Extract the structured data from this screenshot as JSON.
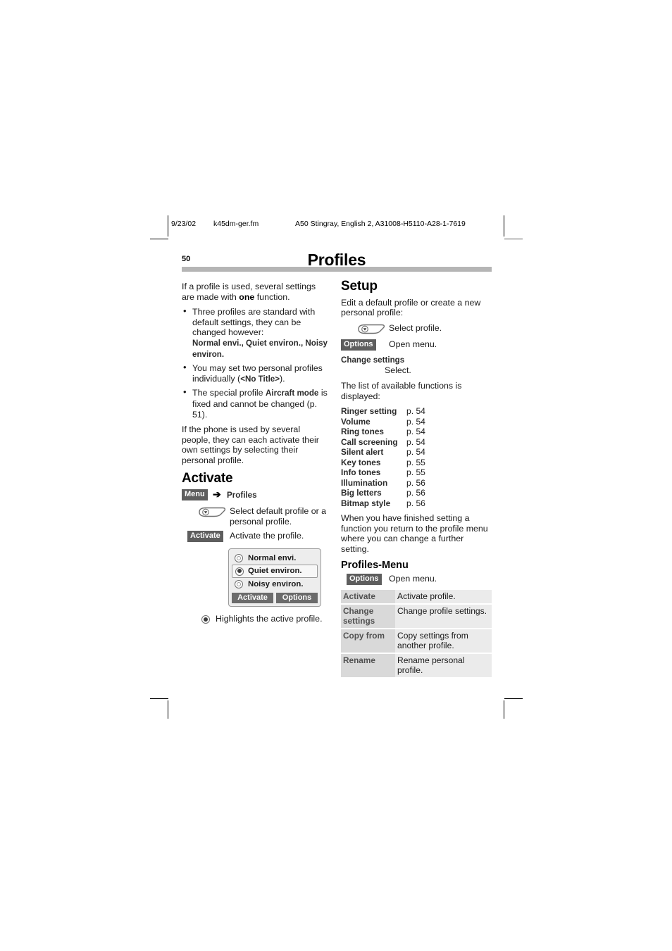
{
  "print_header": {
    "date": "9/23/02",
    "filename": "k45dm-ger.fm",
    "document": "A50 Stingray, English 2, A31008-H5110-A28-1-7619"
  },
  "page": {
    "number": "50",
    "title": "Profiles"
  },
  "left_column": {
    "intro_before": "If a profile is used, several settings are made with ",
    "intro_bold": "one",
    "intro_after": " function.",
    "bullets": [
      {
        "text": "Three profiles are standard with default settings, they can be changed however:",
        "keywords": "Normal envi., Quiet environ., Noisy environ."
      },
      {
        "text_before": "You may set two personal profiles individually (",
        "keyword": "<No Title>",
        "text_after": ")."
      },
      {
        "text_before": "The special profile ",
        "keyword": "Aircraft mode",
        "text_after": " is fixed and cannot be changed (p. 51)."
      }
    ],
    "closing": "If the phone is used by several people, they can each activate their own settings by selecting their personal profile.",
    "activate_heading": "Activate",
    "menu_path": {
      "chip": "Menu",
      "arrow": "➔",
      "target": "Profiles"
    },
    "steps": [
      {
        "key_icon": "rocker-down-key",
        "desc": "Select default profile or a personal profile."
      },
      {
        "chip": "Activate",
        "desc": "Activate the profile."
      }
    ],
    "mockup": {
      "rows": [
        {
          "label": "Normal envi.",
          "selected": false,
          "active": false
        },
        {
          "label": "Quiet environ.",
          "selected": true,
          "active": true
        },
        {
          "label": "Noisy environ.",
          "selected": false,
          "active": false
        }
      ],
      "softkeys": [
        "Activate",
        "Options"
      ]
    },
    "legend": "Highlights the active profile."
  },
  "right_column": {
    "setup_heading": "Setup",
    "setup_intro": "Edit a default profile or create a new personal profile:",
    "setup_steps": [
      {
        "key_icon": "rocker-down-key",
        "desc": "Select profile."
      },
      {
        "chip": "Options",
        "desc": "Open menu."
      }
    ],
    "change_settings_label": "Change settings",
    "change_settings_action": "Select.",
    "list_intro": "The list of available functions is displayed:",
    "functions": [
      {
        "name": "Ringer setting",
        "page": "p. 54"
      },
      {
        "name": "Volume",
        "page": "p. 54"
      },
      {
        "name": "Ring tones",
        "page": "p. 54"
      },
      {
        "name": "Call screening",
        "page": "p. 54"
      },
      {
        "name": "Silent alert",
        "page": "p. 54"
      },
      {
        "name": "Key tones",
        "page": "p. 55"
      },
      {
        "name": "Info tones",
        "page": "p. 55"
      },
      {
        "name": "Illumination",
        "page": "p. 56"
      },
      {
        "name": "Big letters",
        "page": "p. 56"
      },
      {
        "name": "Bitmap style",
        "page": "p. 56"
      }
    ],
    "after_list": "When you have finished setting a function you return to the profile menu where you can change a further setting.",
    "profiles_menu_heading": "Profiles-Menu",
    "profiles_menu_step": {
      "chip": "Options",
      "desc": "Open menu."
    },
    "options_table": [
      {
        "key": "Activate",
        "value": "Activate profile."
      },
      {
        "key": "Change settings",
        "value": "Change profile settings."
      },
      {
        "key": "Copy from",
        "value": "Copy settings from another profile."
      },
      {
        "key": "Rename",
        "value": "Rename personal profile."
      }
    ]
  },
  "colors": {
    "chip_background": "#5e5e5e",
    "rule_gray": "#b5b5b5",
    "table_key_background": "#d9d9d9",
    "table_value_background": "#ebebeb",
    "mockup_background": "#ededed"
  }
}
